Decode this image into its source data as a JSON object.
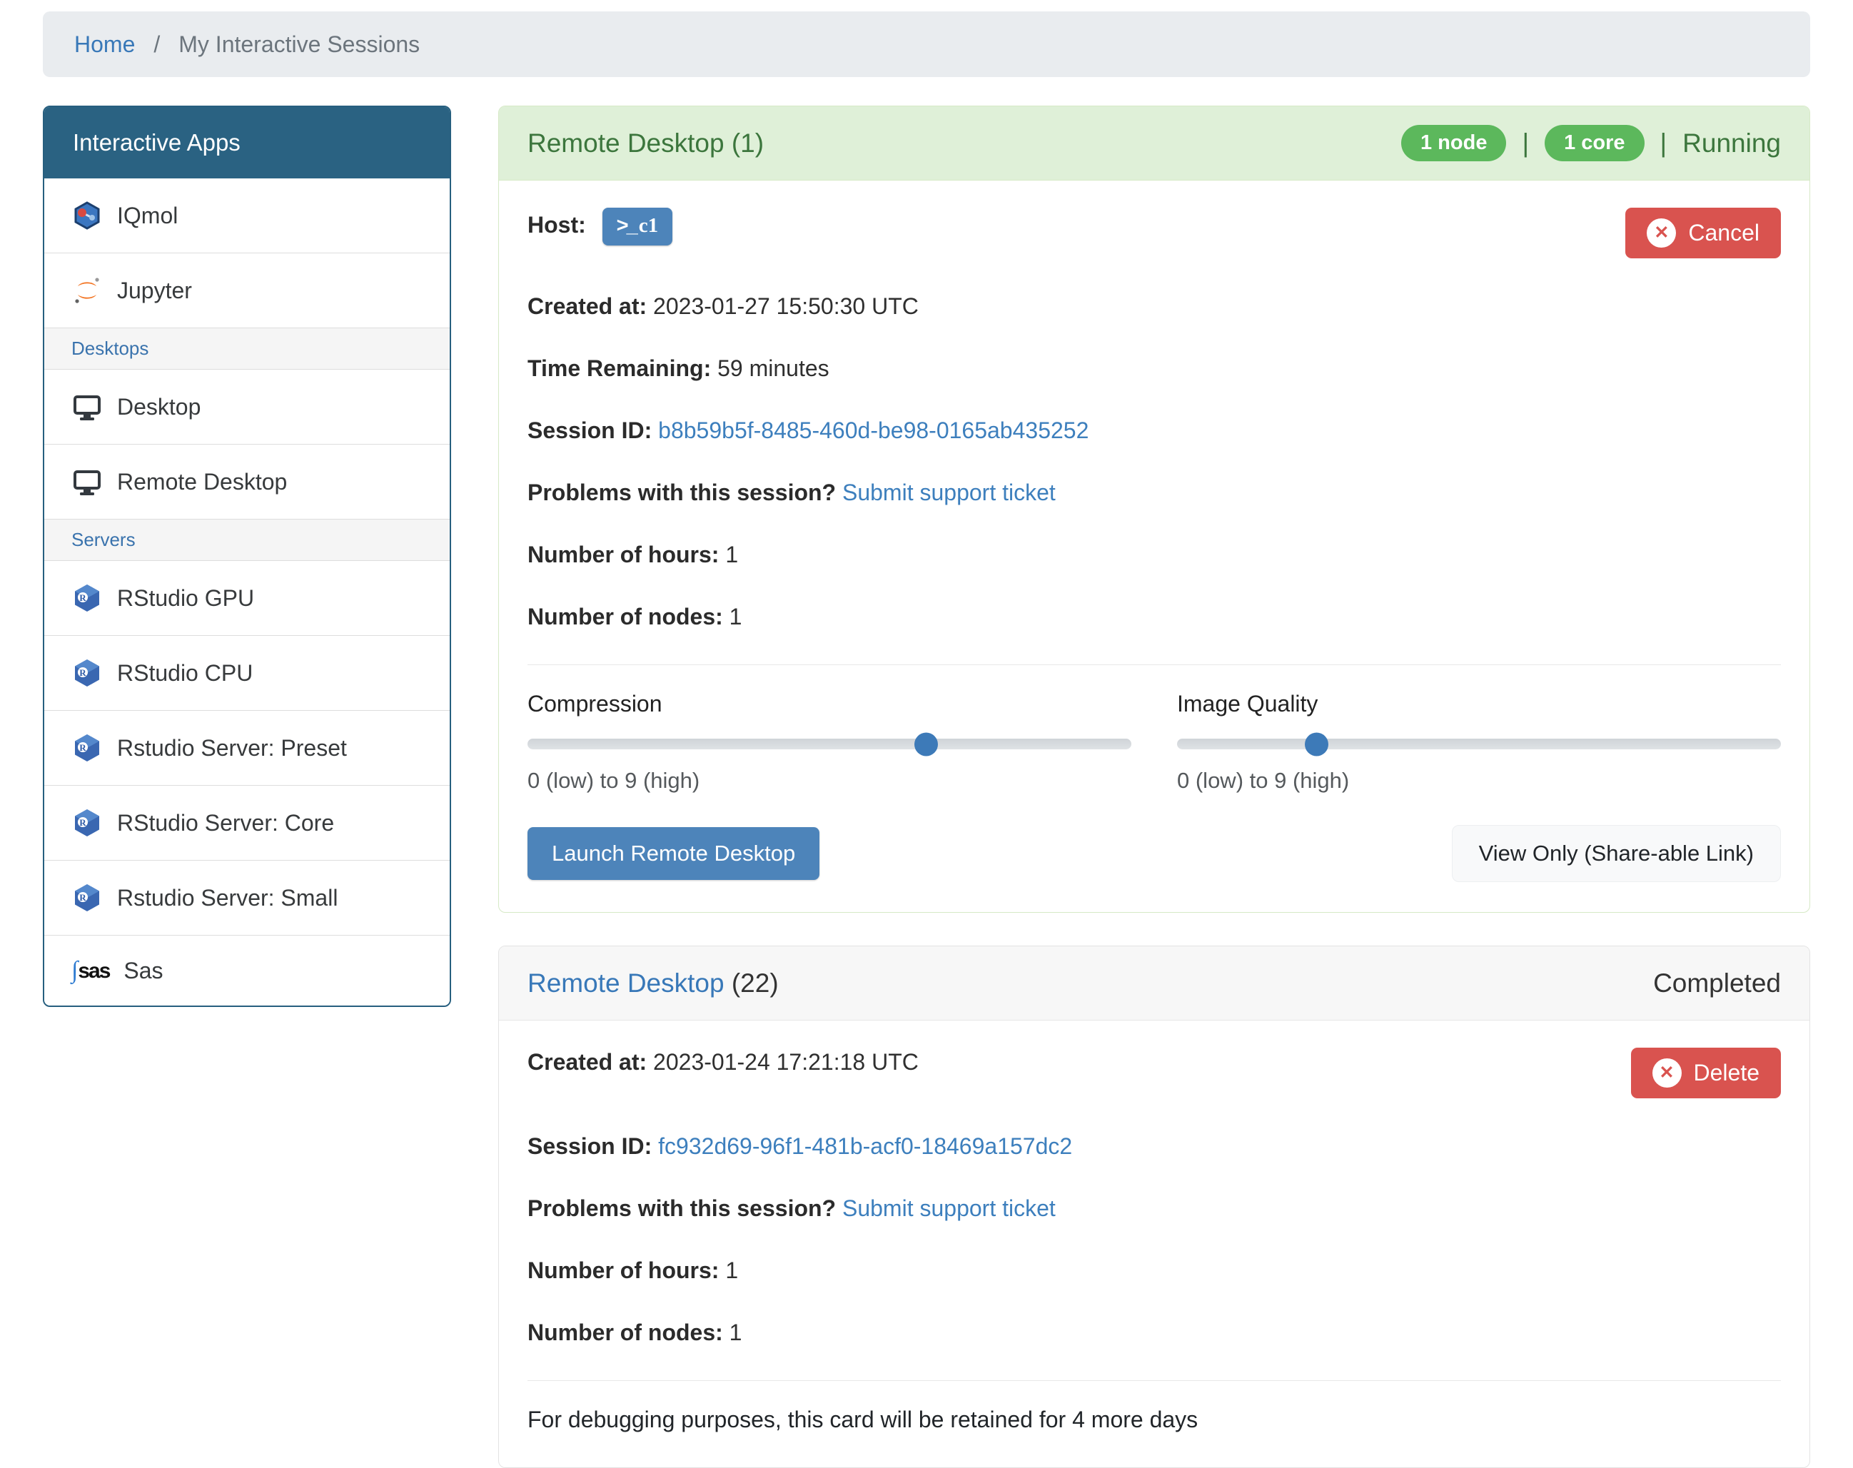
{
  "breadcrumb": {
    "home": "Home",
    "separator": "/",
    "current": "My Interactive Sessions"
  },
  "sidebar": {
    "title": "Interactive Apps",
    "sas_icon_swoosh": "∫",
    "sas_icon_text": "sas",
    "items": [
      {
        "label": "IQmol",
        "icon": "iqmol-icon",
        "type": "app"
      },
      {
        "label": "Jupyter",
        "icon": "jupyter-icon",
        "type": "app"
      },
      {
        "label": "Desktops",
        "type": "section"
      },
      {
        "label": "Desktop",
        "icon": "monitor-icon",
        "type": "app"
      },
      {
        "label": "Remote Desktop",
        "icon": "monitor-icon",
        "type": "app"
      },
      {
        "label": "Servers",
        "type": "section"
      },
      {
        "label": "RStudio GPU",
        "icon": "rstudio-icon",
        "type": "app"
      },
      {
        "label": "RStudio CPU",
        "icon": "rstudio-icon",
        "type": "app"
      },
      {
        "label": "Rstudio Server: Preset",
        "icon": "rstudio-icon",
        "type": "app"
      },
      {
        "label": "RStudio Server: Core",
        "icon": "rstudio-icon",
        "type": "app"
      },
      {
        "label": "Rstudio Server: Small",
        "icon": "rstudio-icon",
        "type": "app"
      },
      {
        "label": "Sas",
        "icon": "sas-icon",
        "type": "app"
      }
    ]
  },
  "session_running": {
    "title": "Remote Desktop (1)",
    "badges": [
      {
        "label": "1 node"
      },
      {
        "label": "1 core"
      }
    ],
    "badge_separator": "|",
    "status": "Running",
    "host_label": "Host:",
    "host_icon": ">_",
    "host_name": "c1",
    "cancel_label": "Cancel",
    "cancel_icon_glyph": "✕",
    "created_label": "Created at:",
    "created_value": "2023-01-27 15:50:30 UTC",
    "time_label": "Time Remaining:",
    "time_value": "59 minutes",
    "session_id_label": "Session ID:",
    "session_id_value": "b8b59b5f-8485-460d-be98-0165ab435252",
    "problems_label": "Problems with this session?",
    "problems_link": "Submit support ticket",
    "hours_label": "Number of hours:",
    "hours_value": "1",
    "nodes_label": "Number of nodes:",
    "nodes_value": "1",
    "compression": {
      "label": "Compression",
      "hint": "0 (low) to 9 (high)",
      "value_percent": 66
    },
    "image_quality": {
      "label": "Image Quality",
      "hint": "0 (low) to 9 (high)",
      "value_percent": 23
    },
    "launch_label": "Launch Remote Desktop",
    "view_only_label": "View Only (Share-able Link)"
  },
  "session_completed": {
    "title_link": "Remote Desktop",
    "count": "(22)",
    "status": "Completed",
    "delete_label": "Delete",
    "delete_icon_glyph": "✕",
    "created_label": "Created at:",
    "created_value": "2023-01-24 17:21:18 UTC",
    "session_id_label": "Session ID:",
    "session_id_value": "fc932d69-96f1-481b-acf0-18469a157dc2",
    "problems_label": "Problems with this session?",
    "problems_link": "Submit support ticket",
    "hours_label": "Number of hours:",
    "hours_value": "1",
    "nodes_label": "Number of nodes:",
    "nodes_value": "1",
    "retention_note": "For debugging purposes, this card will be retained for 4 more days"
  },
  "colors": {
    "sidebar_header_bg": "#2a6282",
    "success_header_bg": "#dff0d8",
    "success_text": "#3c763d",
    "badge_green": "#5cb85c",
    "danger_red": "#d9534f",
    "primary_blue": "#4d84ba",
    "link_blue": "#3d7fbd",
    "breadcrumb_bg": "#e9ecef"
  }
}
